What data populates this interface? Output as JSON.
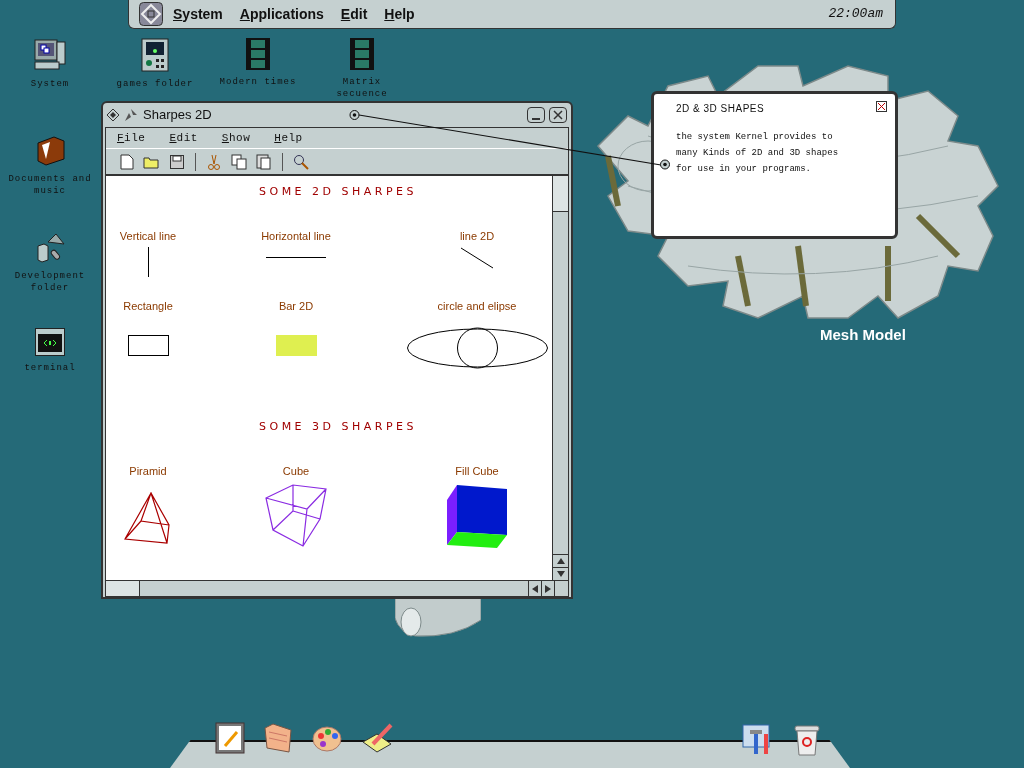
{
  "menu_bar": {
    "items": [
      "System",
      "Applications",
      "Edit",
      "Help"
    ],
    "clock": "22:00am"
  },
  "desktop_icons": [
    {
      "label": "System",
      "kind": "computer"
    },
    {
      "label": "games folder",
      "kind": "games"
    },
    {
      "label": "Modern times",
      "kind": "film"
    },
    {
      "label": "Matrix secuence",
      "kind": "film"
    },
    {
      "label": "Documents and music",
      "kind": "folder"
    },
    {
      "label": "Development folder",
      "kind": "dev"
    },
    {
      "label": "terminal",
      "kind": "terminal"
    }
  ],
  "window": {
    "title": "Sharpes 2D",
    "menu": [
      "File",
      "Edit",
      "Show",
      "Help"
    ],
    "sections": [
      {
        "heading": "SOME 2D SHARPES",
        "rows": [
          [
            {
              "label": "Vertical line",
              "kind": "vline"
            },
            {
              "label": "Horizontal line",
              "kind": "hline"
            },
            {
              "label": "line 2D",
              "kind": "dline"
            }
          ],
          [
            {
              "label": "Rectangle",
              "kind": "rect"
            },
            {
              "label": "Bar 2D",
              "kind": "bar"
            },
            {
              "label": "circle and elipse",
              "kind": "ellipse"
            }
          ]
        ]
      },
      {
        "heading": "SOME 3D SHARPES",
        "rows": [
          [
            {
              "label": "Piramid",
              "kind": "pyramid"
            },
            {
              "label": "Cube",
              "kind": "cube"
            },
            {
              "label": "Fill Cube",
              "kind": "fillcube"
            }
          ]
        ]
      }
    ]
  },
  "info_box": {
    "title": "2D & 3D SHAPES",
    "text": "the system Kernel provides to many Kinds of 2D and 3D shapes for use in your programs."
  },
  "mesh_label": "Mesh Model"
}
